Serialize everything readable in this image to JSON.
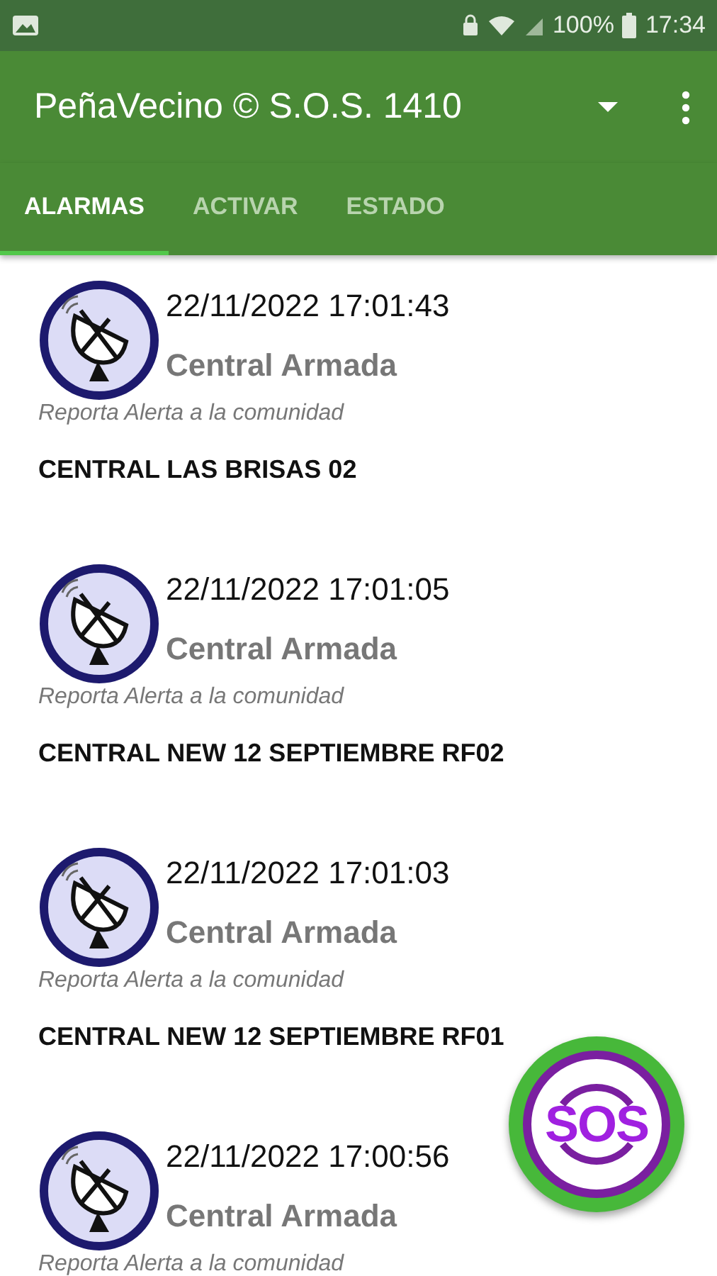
{
  "status_bar": {
    "battery": "100%",
    "time": "17:34"
  },
  "app_bar": {
    "title": "PeñaVecino © S.O.S. 1410"
  },
  "tabs": [
    {
      "label": "ALARMAS",
      "selected": true
    },
    {
      "label": "ACTIVAR",
      "selected": false
    },
    {
      "label": "ESTADO",
      "selected": false
    }
  ],
  "alarms": [
    {
      "datetime": "22/11/2022 17:01:43",
      "type": "Central Armada",
      "description": "Reporta Alerta a la comunidad",
      "name": "CENTRAL LAS BRISAS 02"
    },
    {
      "datetime": "22/11/2022 17:01:05",
      "type": "Central Armada",
      "description": "Reporta Alerta a la comunidad",
      "name": "CENTRAL NEW 12 SEPTIEMBRE RF02"
    },
    {
      "datetime": "22/11/2022 17:01:03",
      "type": "Central Armada",
      "description": "Reporta Alerta a la comunidad",
      "name": "CENTRAL NEW 12 SEPTIEMBRE RF01"
    },
    {
      "datetime": "22/11/2022 17:00:56",
      "type": "Central Armada",
      "description": "Reporta Alerta a la comunidad"
    }
  ],
  "fab": {
    "label": "SOS"
  }
}
